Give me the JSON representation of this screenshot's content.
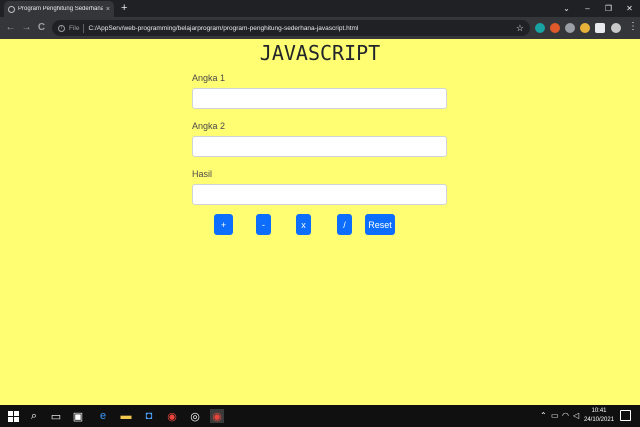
{
  "browser": {
    "tab_title": "Program Penghitung Sederhana...",
    "tab_close": "×",
    "new_tab": "+",
    "window_controls": [
      "⌄",
      "–",
      "❐",
      "✕"
    ],
    "nav": {
      "back": "←",
      "forward": "→",
      "reload": "C"
    },
    "address_scheme": "File",
    "address_url": "C:/AppServ/web-programming/belajarprogram/program-penghitung-sederhana-javascript.html",
    "extension_colors": [
      "#1aa3a3",
      "#e0592a",
      "#9aa0a6",
      "#e8b23a"
    ]
  },
  "page": {
    "title": "JAVASCRIPT",
    "fields": [
      {
        "label": "Angka 1",
        "value": ""
      },
      {
        "label": "Angka 2",
        "value": ""
      },
      {
        "label": "Hasil",
        "value": ""
      }
    ],
    "buttons": [
      {
        "label": "+"
      },
      {
        "label": "-"
      },
      {
        "label": "x"
      },
      {
        "label": "/"
      },
      {
        "label": "Reset"
      }
    ],
    "accent_color": "#0d6efd",
    "background_color": "#fffd72"
  },
  "taskbar": {
    "time": "10:41",
    "date": "24/10/2021"
  }
}
